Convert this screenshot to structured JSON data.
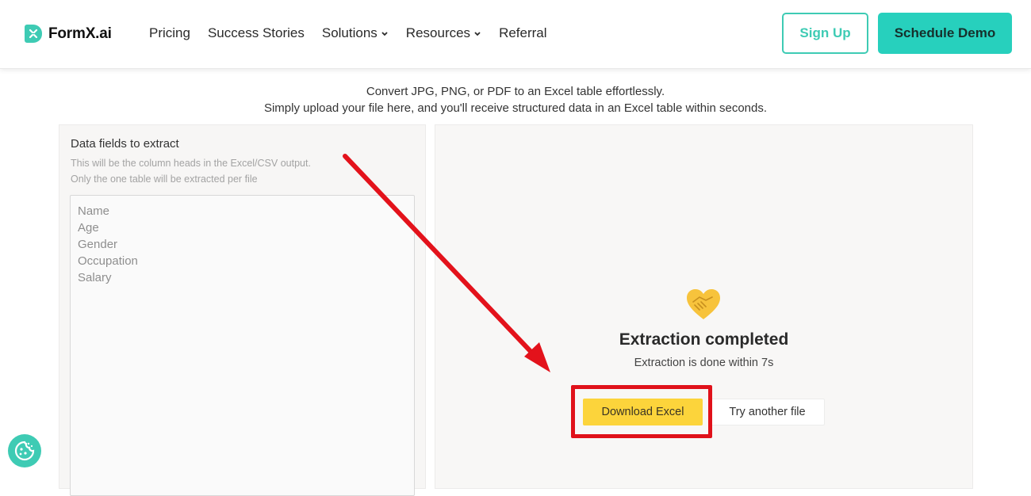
{
  "brand": {
    "name": "FormX.ai",
    "accent_color": "#3ecbb4"
  },
  "nav": {
    "items": [
      {
        "label": "Pricing",
        "has_dropdown": false
      },
      {
        "label": "Success Stories",
        "has_dropdown": false
      },
      {
        "label": "Solutions",
        "has_dropdown": true
      },
      {
        "label": "Resources",
        "has_dropdown": true
      },
      {
        "label": "Referral",
        "has_dropdown": false
      }
    ],
    "signup_label": "Sign Up",
    "demo_label": "Schedule Demo"
  },
  "intro": {
    "line1": "Convert JPG, PNG, or PDF to an Excel table effortlessly.",
    "line2": "Simply upload your file here, and you'll receive structured data in an Excel table within seconds."
  },
  "fields_panel": {
    "title": "Data fields to extract",
    "help_line1": "This will be the column heads in the Excel/CSV output.",
    "help_line2": "Only the one table will be extracted per file",
    "fields": [
      "Name",
      "Age",
      "Gender",
      "Occupation",
      "Salary"
    ]
  },
  "result_panel": {
    "icon": "handshake-icon",
    "title": "Extraction completed",
    "subtitle": "Extraction is done within 7s",
    "download_label": "Download Excel",
    "try_another_label": "Try another file"
  },
  "annotation": {
    "color": "#e0111a",
    "target": "download-excel-button"
  },
  "cookie": {
    "icon": "cookie-icon"
  }
}
